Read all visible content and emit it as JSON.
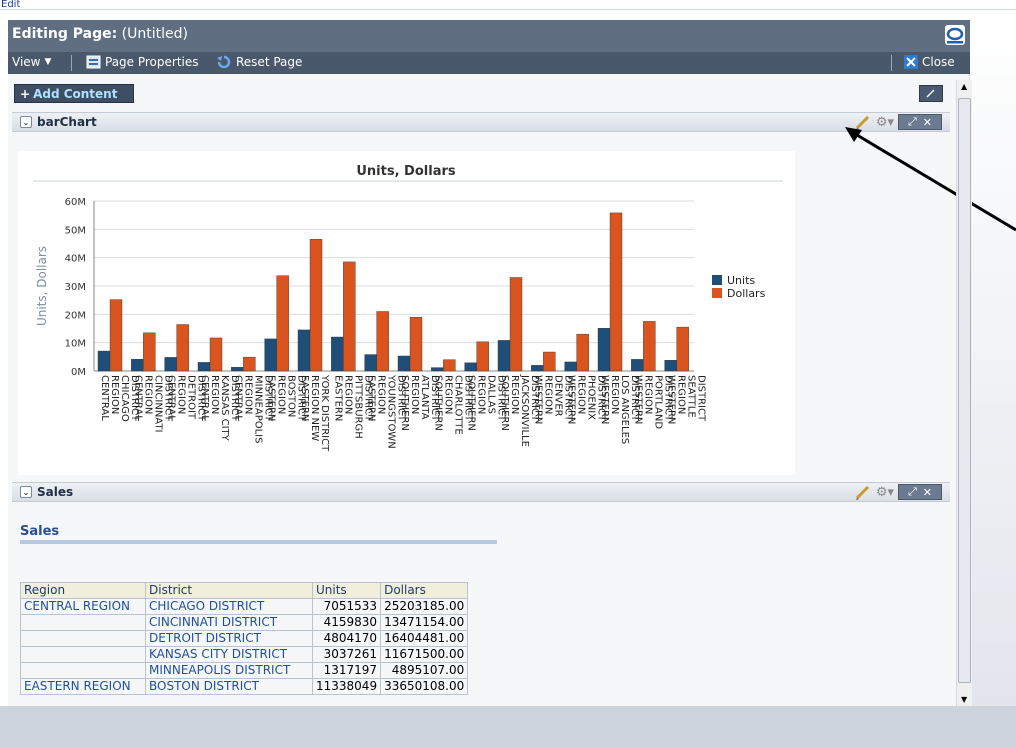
{
  "top_link": "Edit",
  "header": {
    "title_bold": "Editing Page:",
    "title_rest": " (Untitled)"
  },
  "toolbar": {
    "view_label": "View",
    "page_properties_label": "Page Properties",
    "reset_page_label": "Reset Page",
    "close_label": "Close"
  },
  "add_content_label": "Add Content",
  "bar_panel": {
    "title": "barChart"
  },
  "sales_panel": {
    "title": "Sales",
    "heading": "Sales"
  },
  "chart_data": {
    "type": "bar",
    "title": "Units, Dollars",
    "ylabel": "Units, Dollars",
    "ylim": [
      0,
      60000000
    ],
    "yticks": [
      "0M",
      "10M",
      "20M",
      "30M",
      "40M",
      "50M",
      "60M"
    ],
    "categories": [
      [
        "CENTRAL",
        "REGION",
        "CHICAGO",
        "DISTRICT"
      ],
      [
        "CENTRAL",
        "REGION",
        "CINCINNATI",
        "DISTRICT"
      ],
      [
        "CENTRAL",
        "REGION",
        "DETROIT",
        "DISTRICT"
      ],
      [
        "CENTRAL",
        "REGION",
        "KANSAS CITY",
        "DISTRICT"
      ],
      [
        "CENTRAL",
        "REGION",
        "MINNEAPOLIS",
        "DISTRICT"
      ],
      [
        "EASTERN",
        "REGION",
        "BOSTON",
        "DISTRICT"
      ],
      [
        "EASTERN",
        "REGION NEW",
        "YORK DISTRICT"
      ],
      [
        "EASTERN",
        "REGION",
        "PITTSBURGH",
        "DISTRICT"
      ],
      [
        "EASTERN",
        "REGION",
        "YOUNGSTOWN",
        "DISTRICT"
      ],
      [
        "SOUTHERN",
        "REGION",
        "ATLANTA",
        "DISTRICT"
      ],
      [
        "SOUTHERN",
        "REGION",
        "CHARLOTTE",
        "DISTRICT"
      ],
      [
        "SOUTHERN",
        "REGION",
        "DALLAS",
        "DISTRICT"
      ],
      [
        "SOUTHERN",
        "REGION",
        "JACKSONVILLE",
        "DISTRICT"
      ],
      [
        "WESTERN",
        "REGION",
        "DENVER",
        "DISTRICT"
      ],
      [
        "WESTERN",
        "REGION",
        "PHOENIX",
        "DISTRICT"
      ],
      [
        "WESTERN",
        "REGION",
        "LOS ANGELES",
        "DISTRICT"
      ],
      [
        "WESTERN",
        "REGION",
        "PORTLAND",
        "DISTRICT"
      ],
      [
        "WESTERN",
        "REGION",
        "SEATTLE",
        "DISTRICT"
      ]
    ],
    "series": [
      {
        "name": "Units",
        "color": "#1f4e79",
        "values": [
          7051533,
          4159830,
          4804170,
          3037261,
          1317197,
          11338049,
          14500000,
          12000000,
          5800000,
          5300000,
          1200000,
          2900000,
          10800000,
          2000000,
          3200000,
          15100000,
          4100000,
          3800000
        ]
      },
      {
        "name": "Dollars",
        "color": "#d9541e",
        "values": [
          25203185,
          13471154,
          16404481,
          11671500,
          4895107,
          33650108,
          46500000,
          38500000,
          21000000,
          19000000,
          4000000,
          10300000,
          33000000,
          6700000,
          13000000,
          55800000,
          17500000,
          15500000
        ]
      }
    ],
    "legend": "right"
  },
  "sales_table": {
    "headers": [
      "Region",
      "District",
      "Units",
      "Dollars"
    ],
    "rows": [
      [
        "CENTRAL REGION",
        "CHICAGO DISTRICT",
        "7051533",
        "25203185.00"
      ],
      [
        "",
        "CINCINNATI DISTRICT",
        "4159830",
        "13471154.00"
      ],
      [
        "",
        "DETROIT DISTRICT",
        "4804170",
        "16404481.00"
      ],
      [
        "",
        "KANSAS CITY DISTRICT",
        "3037261",
        "11671500.00"
      ],
      [
        "",
        "MINNEAPOLIS DISTRICT",
        "1317197",
        "4895107.00"
      ],
      [
        "EASTERN REGION",
        "BOSTON DISTRICT",
        "11338049",
        "33650108.00"
      ]
    ]
  }
}
